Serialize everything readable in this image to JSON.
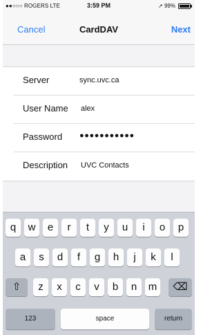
{
  "status_bar": {
    "carrier": "●●○○○ ROGERS  LTE",
    "time": "3:59 PM",
    "location_icon": "➚",
    "battery_percent": "99%"
  },
  "nav": {
    "cancel": "Cancel",
    "title": "CardDAV",
    "next": "Next"
  },
  "form": {
    "server": {
      "label": "Server",
      "value": "sync.uvc.ca"
    },
    "username": {
      "label": "User Name",
      "value": "alex"
    },
    "password": {
      "label": "Password",
      "value": "●●●●●●●●●●●"
    },
    "description": {
      "label": "Description",
      "value": "UVC Contacts"
    }
  },
  "keyboard": {
    "row1": [
      "q",
      "w",
      "e",
      "r",
      "t",
      "y",
      "u",
      "i",
      "o",
      "p"
    ],
    "row2": [
      "a",
      "s",
      "d",
      "f",
      "g",
      "h",
      "j",
      "k",
      "l"
    ],
    "row3": [
      "z",
      "x",
      "c",
      "v",
      "b",
      "n",
      "m"
    ],
    "shift_icon": "⇧",
    "delete_icon": "⌫",
    "numbers": "123",
    "space": "space",
    "return": "return"
  }
}
